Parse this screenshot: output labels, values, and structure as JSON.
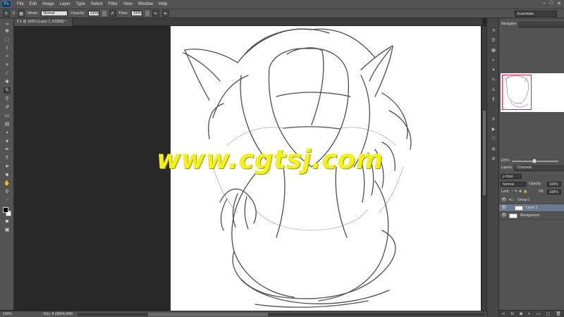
{
  "app": {
    "logo": "Ps"
  },
  "menu": [
    "File",
    "Edit",
    "Image",
    "Layer",
    "Type",
    "Select",
    "Filter",
    "View",
    "Window",
    "Help"
  ],
  "window_controls": [
    "–",
    "□",
    "✕"
  ],
  "options_bar": {
    "brush_size": "2",
    "mode_label": "Mode:",
    "mode_value": "Normal",
    "opacity_label": "Opacity:",
    "opacity_value": "100%",
    "flow_label": "Flow:",
    "flow_value": "100%",
    "workspace": "Essentials"
  },
  "document_tab": "0 1 @ 100% (Layer 1, RGB/8) *",
  "status": {
    "zoom": "100%",
    "doc_info": "Doc: 8.33M/4.00M"
  },
  "panels": {
    "navigator_title": "Navigator",
    "nav_zoom": "100%",
    "layers_tab": "Layers",
    "channels_tab": "Channels",
    "kind_label": "ρ Kind",
    "blend_mode": "Normal",
    "opacity_label": "Opacity:",
    "opacity_value": "100%",
    "lock_label": "Lock:",
    "fill_label": "Fill:",
    "fill_value": "100%",
    "layers": [
      {
        "name": "Group 1"
      },
      {
        "name": "Layer 1"
      },
      {
        "name": "Background"
      }
    ]
  },
  "watermark": "www.cgtsj.com",
  "icons": {
    "tools": [
      "move-icon",
      "marquee-icon",
      "lasso-icon",
      "quick-select-icon",
      "crop-icon",
      "eyedropper-icon",
      "healing-icon",
      "brush-icon",
      "clone-stamp-icon",
      "history-brush-icon",
      "eraser-icon",
      "gradient-icon",
      "blur-icon",
      "dodge-icon",
      "pen-icon",
      "type-icon",
      "path-select-icon",
      "shape-icon",
      "hand-icon",
      "zoom-icon"
    ]
  }
}
